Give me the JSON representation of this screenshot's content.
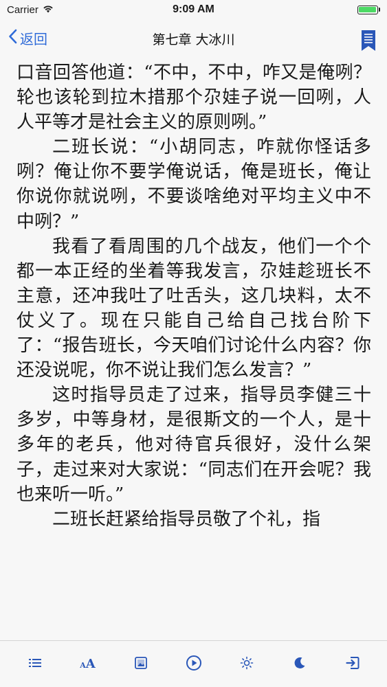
{
  "status_bar": {
    "carrier": "Carrier",
    "time": "9:09 AM"
  },
  "nav": {
    "back_label": "返回",
    "title": "第七章 大冰川"
  },
  "content": {
    "paragraphs": [
      {
        "text": "口音回答他道：“不中，不中，咋又是俺咧？轮也该轮到拉木措那个尕娃子说一回咧，人人平等才是社会主义的原则咧。”",
        "indent": false
      },
      {
        "text": "二班长说：“小胡同志，咋就你怪话多咧？俺让你不要学俺说话，俺是班长，俺让你说你就说咧，不要谈啥绝对平均主义中不中咧？”",
        "indent": true
      },
      {
        "text": "我看了看周围的几个战友，他们一个个都一本正经的坐着等我发言，尕娃趁班长不主意，还冲我吐了吐舌头，这几块料，太不仗义了。现在只能自己给自己找台阶下了：“报告班长，今天咱们讨论什么内容？你还没说呢，你不说让我们怎么发言？”",
        "indent": true
      },
      {
        "text": "这时指导员走了过来，指导员李健三十多岁，中等身材，是很斯文的一个人，是十多年的老兵，他对待官兵很好，没什么架子，走过来对大家说：“同志们在开会呢？我也来听一听。”",
        "indent": true
      },
      {
        "text": "二班长赶紧给指导员敬了个礼，指",
        "indent": true
      }
    ]
  },
  "toolbar": {
    "aa_small": "A",
    "aa_big": "A"
  },
  "colors": {
    "accent": "#2f6bd8",
    "toolbar_icon": "#2a57b8",
    "battery": "#4cd964"
  }
}
